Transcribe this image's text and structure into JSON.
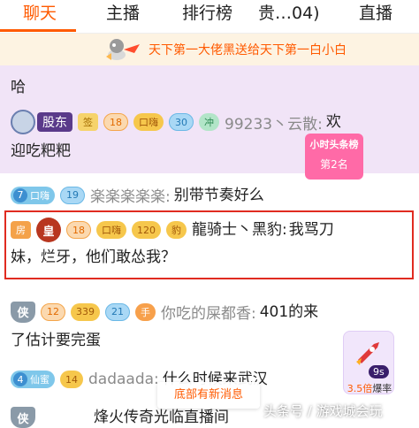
{
  "tabs": [
    {
      "label": "聊天",
      "active": true
    },
    {
      "label": "主播",
      "active": false
    },
    {
      "label": "排行榜",
      "active": false
    },
    {
      "label": "贵…04)",
      "active": false
    },
    {
      "label": "直播",
      "active": false
    }
  ],
  "marquee": {
    "text": "天下第一大佬黑送给天下第一白小白"
  },
  "banner": {
    "title": "小时头条榜",
    "rank": "第2名"
  },
  "messages": [
    {
      "text": "哈"
    },
    {
      "name": "股东",
      "badge_sign": "签",
      "level": "18",
      "fan_name": "口嗨",
      "fan_level": "30",
      "badge_rush": "冲",
      "user": "99233丶云散:",
      "text_line1": "欢",
      "text_line2": "迎吃粑粑"
    },
    {
      "fan_level_num": "7",
      "fan_name": "口嗨",
      "badge_num": "19",
      "user": "楽楽楽楽楽:",
      "text": "别带节奏好么"
    },
    {
      "badge_fang": "房",
      "badge_crown": "皇",
      "level": "18",
      "fan_name": "口嗨",
      "badge_num": "120",
      "badge_tag": "豹",
      "user": "龍骑士丶黑豹:",
      "text_line1": "我骂刀",
      "text_line2": "妹，烂牙，他们敢怂我？"
    },
    {
      "badge_shield": "侠",
      "level": "12",
      "level_num": "339",
      "badge_num": "21",
      "badge_tag": "手",
      "user": "你吃的屎都香:",
      "text_line1": "401的来",
      "text_line2": "了估计要完蛋"
    },
    {
      "fan_level_num": "4",
      "fan_name": "仙蜜",
      "badge_num": "14",
      "user": "dadaada:",
      "text": "什么时候来武汉"
    },
    {
      "badge_shield": "侠",
      "text": "烽火传奇光临直播间"
    }
  ],
  "rocket": {
    "timer": "9s",
    "multiplier": "3.5倍",
    "label": "爆率"
  },
  "toast": {
    "text": "底部有新消息"
  },
  "watermark": {
    "text": "头条号 / 游戏城会玩"
  },
  "colors": {
    "accent": "#ff5a00",
    "highlight_border": "#e02b20",
    "chat_bg_purple": "#f1e4f7"
  }
}
